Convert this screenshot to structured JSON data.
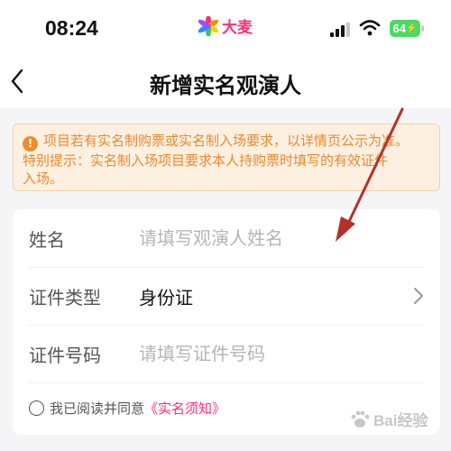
{
  "status_bar": {
    "time": "08:24",
    "brand_name": "大麦",
    "battery": "64"
  },
  "nav": {
    "title": "新增实名观演人",
    "back_icon": "chevron-left-icon"
  },
  "notice": {
    "icon": "exclamation-circle-icon",
    "lines": [
      "项目若有实名制购票或实名制入场要求，以详情页公示为准。",
      "特别提示：实名制入场项目要求本人持购票时填写的有效证件",
      "入场。"
    ]
  },
  "form": {
    "name": {
      "label": "姓名",
      "placeholder": "请填写观演人姓名"
    },
    "id_type": {
      "label": "证件类型",
      "value": "身份证"
    },
    "id_number": {
      "label": "证件号码",
      "placeholder": "请填写证件号码"
    },
    "agreement": {
      "text": "我已阅读并同意",
      "link": "《实名须知》",
      "checked": false
    }
  },
  "watermark": {
    "text": "Bai经验",
    "icon": "paw-icon"
  },
  "colors": {
    "brand": "#ff2d78",
    "notice_text": "#e78a2f",
    "notice_bg": "#fdf0e1",
    "annotation_arrow": "#b5302a",
    "battery": "#4cd964"
  }
}
